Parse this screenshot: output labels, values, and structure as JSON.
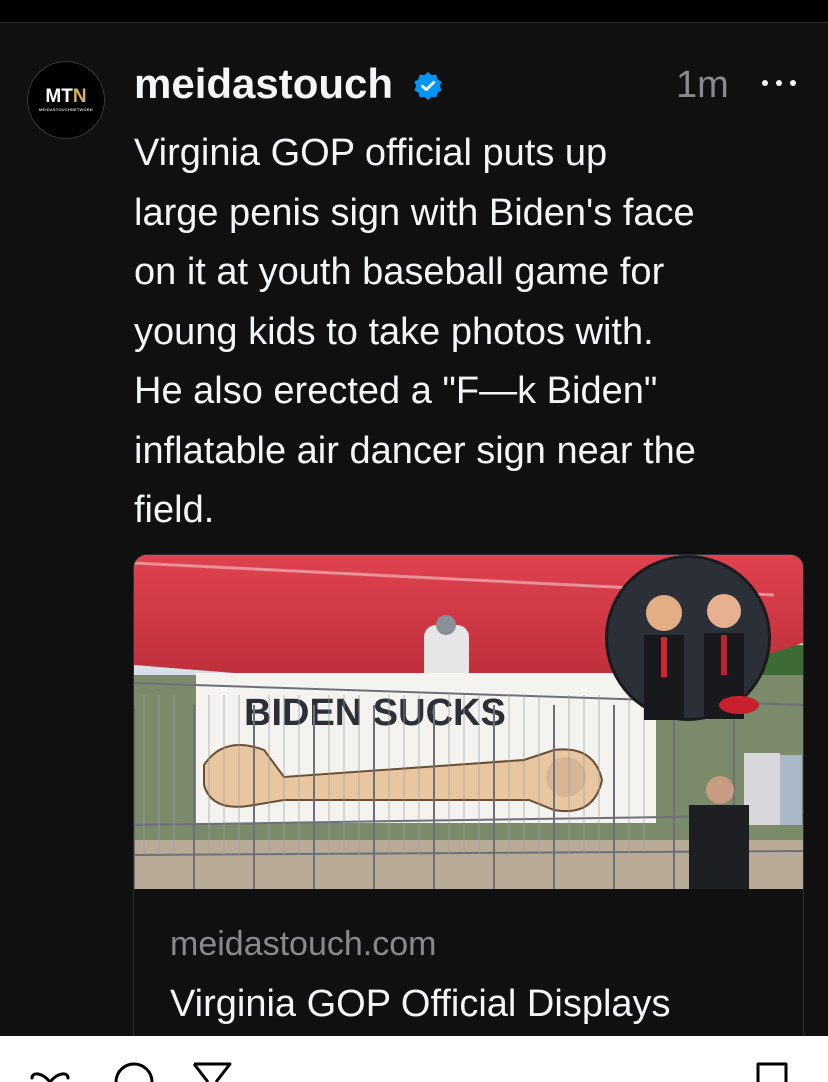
{
  "post": {
    "avatar": {
      "logo_text": "MT",
      "logo_accent": "N",
      "logo_subtext": "MEIDASTOUCHNETWORK"
    },
    "username": "meidastouch",
    "timestamp": "1m",
    "caption": "Virginia GOP official puts up\nlarge penis sign with Biden's face\non it at youth baseball game for\nyoung kids to take photos with.\nHe also erected a \"F—k Biden\"\ninflatable air dancer sign near the\nfield.",
    "link_preview": {
      "image_sign_text": "BIDEN SUCKS",
      "domain": "meidastouch.com",
      "title": "Virginia GOP Official Displays"
    }
  },
  "icons": {
    "verified": "verified-badge-icon",
    "more": "more-options-icon",
    "actions": [
      "heart-icon",
      "comment-icon",
      "repost-icon",
      "bookmark-icon"
    ]
  },
  "colors": {
    "background": "#101010",
    "text_primary": "#f3f5f7",
    "text_secondary": "#8a8a8e",
    "verified_blue": "#0095f6",
    "logo_gold": "#d9b25a"
  }
}
